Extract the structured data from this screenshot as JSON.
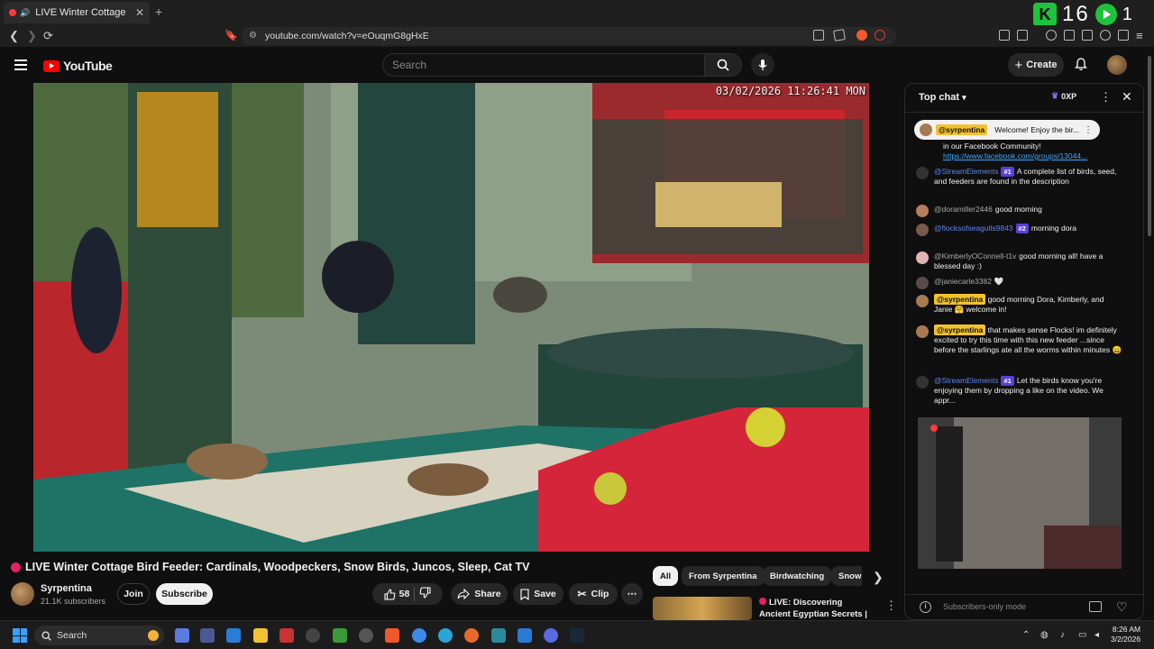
{
  "browser": {
    "tab_title": "LIVE Winter Cottage Bird F",
    "url": "youtube.com/watch?v=eOuqmG8gHxE",
    "overlay_counter": "16",
    "overlay_counter_right": "1"
  },
  "header": {
    "logo_text": "YouTube",
    "search_placeholder": "Search",
    "create_label": "Create"
  },
  "video": {
    "timestamp": "03/02/2026 11:26:41 MON",
    "title": "LIVE Winter Cottage Bird Feeder: Cardinals, Woodpeckers, Snow Birds, Juncos, Sleep, Cat TV"
  },
  "channel": {
    "name": "Syrpentina",
    "subscribers": "21.1K subscribers",
    "join_label": "Join",
    "subscribe_label": "Subscribe"
  },
  "actions": {
    "like_count": "58",
    "share_label": "Share",
    "save_label": "Save",
    "clip_label": "Clip"
  },
  "chips": [
    "All",
    "From Syrpentina",
    "Birdwatching",
    "Snow"
  ],
  "recommended": {
    "title": "LIVE: Discovering Ancient Egyptian Secrets | Lost ..."
  },
  "chat": {
    "title": "Top chat",
    "points_label": "0XP",
    "pinned_mention": "@syrpentina",
    "pinned_text": "Welcome! Enjoy the bir...",
    "top_text": "in our Facebook Community!",
    "top_link": "https://www.facebook.com/groups/13044...",
    "messages": [
      {
        "user": "@StreamElements",
        "badge": "#1",
        "text": "A complete list of birds, seed, and feeders are found in the description",
        "mod": true
      },
      {
        "user": "@doramiller2446",
        "badge": "",
        "text": "good morning",
        "mod": false
      },
      {
        "user": "@flocksofseagulls9843",
        "badge": "#2",
        "text": "morning dora",
        "mod": true
      },
      {
        "user": "@KimberlyOConnell-t1v",
        "badge": "",
        "text": "good morning all! have a blessed day :)",
        "mod": false
      },
      {
        "user": "@janiecarle3382",
        "badge": "",
        "text": "🤍",
        "mod": false
      },
      {
        "user": "",
        "mention": "@syrpentina",
        "badge": "",
        "text": "good morning Dora, Kimberly, and Janie 🤗 welcome in!",
        "mod": false
      },
      {
        "user": "",
        "mention": "@syrpentina",
        "badge": "",
        "text": "that makes sense Flocks! im definitely excited to try this time with this new feeder ...since before the starlings ate all the worms within minutes 😄",
        "mod": false
      },
      {
        "user": "@StreamElements",
        "badge": "#1",
        "text": "Let the birds know you're enjoying them by dropping a like on the video. We appr...",
        "mod": true
      }
    ],
    "footer_placeholder": "Subscribers-only mode"
  },
  "taskbar": {
    "search_label": "Search",
    "time": "8:26 AM",
    "date": "3/2/2026"
  },
  "colors": {
    "yt_red": "#ff0000",
    "live_pink": "#e2235f",
    "mention_yellow": "#f2c230",
    "mod_blue": "#5e84f1",
    "badge_purple": "#5b3fd6"
  }
}
